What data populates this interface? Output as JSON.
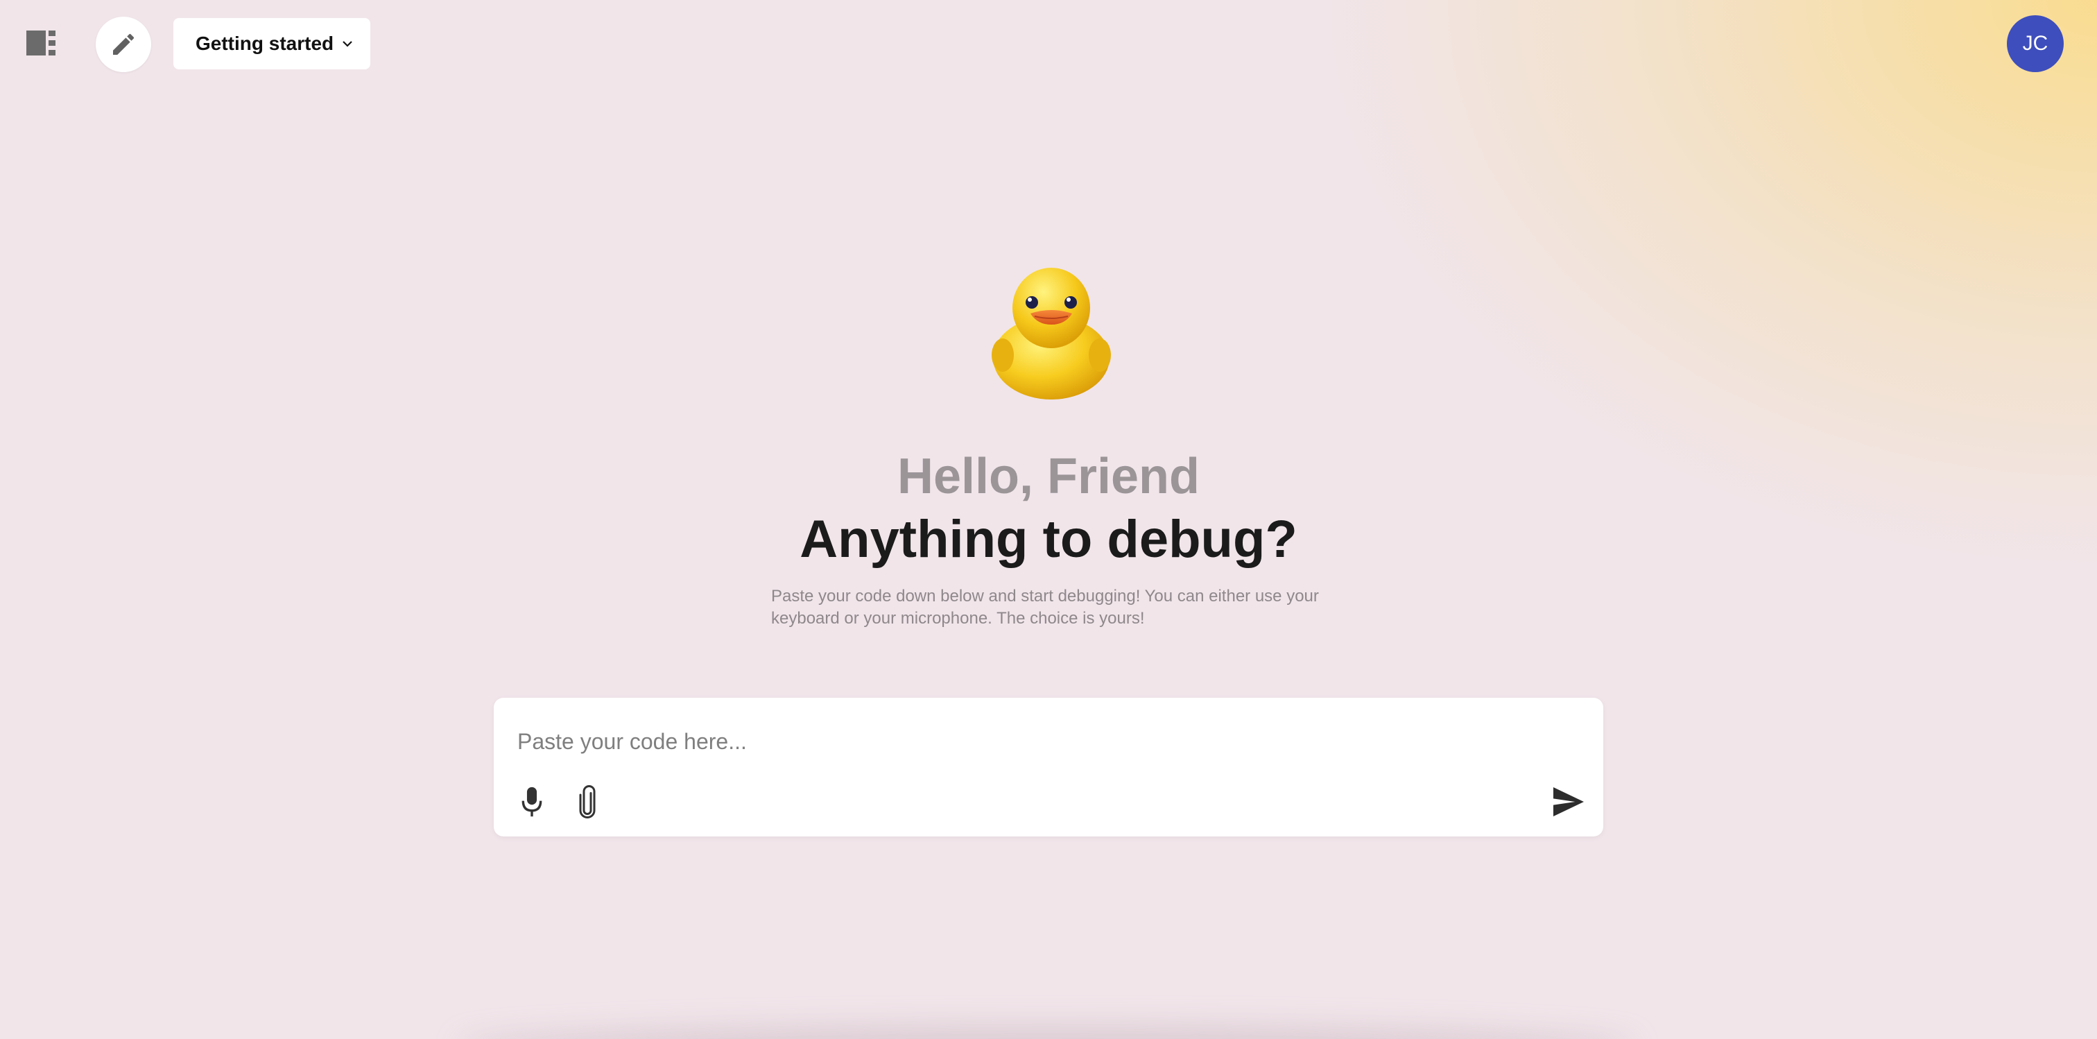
{
  "header": {
    "topic_label": "Getting started",
    "avatar_initials": "JC",
    "sidebar_icon": "sidebar-panel-icon",
    "new_chat_icon": "pencil-icon",
    "dropdown_icon": "chevron-down-icon"
  },
  "hero": {
    "mascot_icon": "rubber-duck-icon",
    "greeting": "Hello, Friend",
    "headline": "Anything to debug?",
    "subtitle": "Paste your code down below and start debugging! You can either use your keyboard or your microphone. The choice is yours!"
  },
  "composer": {
    "placeholder": "Paste your code here...",
    "value": "",
    "mic_icon": "microphone-icon",
    "attach_icon": "paperclip-icon",
    "send_icon": "send-icon"
  },
  "colors": {
    "background": "#f1e5ea",
    "glow": "#f8dc94",
    "avatar": "#3e4ebc",
    "headline": "#1b1b1b",
    "greeting": "#9b9598",
    "subtitle": "#8e888b",
    "duck_yellow": "#f7cc1f",
    "duck_beak": "#e8681e"
  }
}
